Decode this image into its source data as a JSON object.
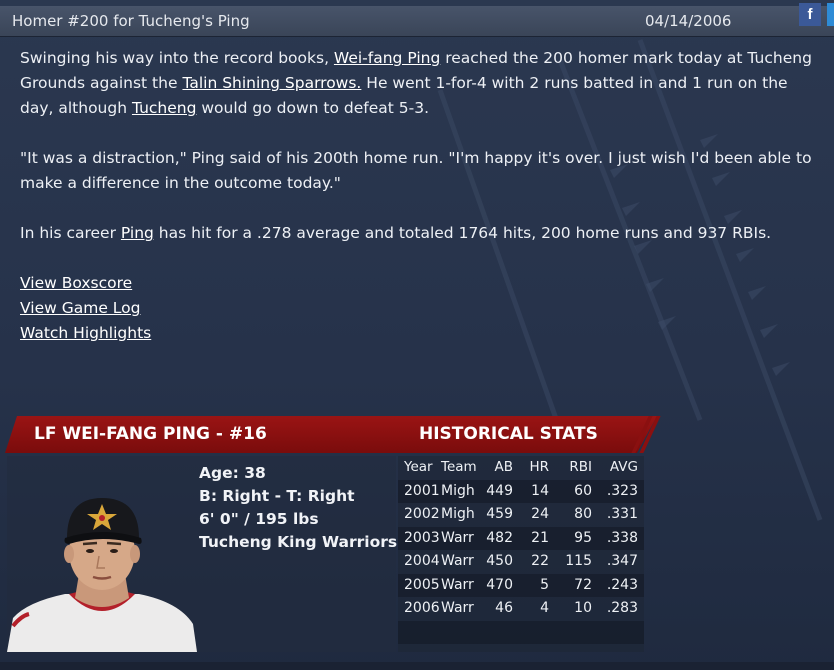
{
  "header": {
    "title": "Homer #200 for Tucheng's Ping",
    "date": "04/14/2006",
    "share_icon_label": "f"
  },
  "article": {
    "p1": {
      "t1": "Swinging his way into the record books, ",
      "link_player": "Wei-fang Ping",
      "t2": " reached the 200 homer mark today at Tucheng Grounds against the ",
      "link_opponent": "Talin Shining Sparrows.",
      "t3": " He went 1-for-4 with 2 runs batted in and 1 run on the day, although ",
      "link_team": "Tucheng",
      "t4": " would go down to defeat 5-3."
    },
    "p2": "\"It was a distraction,\" Ping said of his 200th home run. \"I'm happy it's over. I just wish I'd been able to make a difference in the outcome today.\"",
    "p3": {
      "t1": "In his career ",
      "link_player": "Ping",
      "t2": " has hit for a .278 average and totaled 1764 hits, 200 home runs and 937 RBIs."
    }
  },
  "links": {
    "boxscore": "View Boxscore",
    "game_log": "View Game Log",
    "highlights": "Watch Highlights"
  },
  "player": {
    "banner": "LF WEI-FANG PING - #16",
    "age": "Age: 38",
    "bats_throws": "B: Right - T: Right",
    "size": "6' 0\" / 195 lbs",
    "team": "Tucheng King Warriors"
  },
  "stats": {
    "title": "HISTORICAL STATS",
    "headers": {
      "year": "Year",
      "team": "Team",
      "ab": "AB",
      "hr": "HR",
      "rbi": "RBI",
      "avg": "AVG"
    },
    "rows": [
      {
        "year": "2001",
        "team": "Migh",
        "ab": "449",
        "hr": "14",
        "rbi": "60",
        "avg": ".323"
      },
      {
        "year": "2002",
        "team": "Migh",
        "ab": "459",
        "hr": "24",
        "rbi": "80",
        "avg": ".331"
      },
      {
        "year": "2003",
        "team": "Warr",
        "ab": "482",
        "hr": "21",
        "rbi": "95",
        "avg": ".338"
      },
      {
        "year": "2004",
        "team": "Warr",
        "ab": "450",
        "hr": "22",
        "rbi": "115",
        "avg": ".347"
      },
      {
        "year": "2005",
        "team": "Warr",
        "ab": "470",
        "hr": "5",
        "rbi": "72",
        "avg": ".243"
      },
      {
        "year": "2006",
        "team": "Warr",
        "ab": "46",
        "hr": "4",
        "rbi": "10",
        "avg": ".283"
      }
    ]
  },
  "colors": {
    "banner_red": "#8b1010",
    "facebook_blue": "#3b5998",
    "accent_blue": "#2e8bd6",
    "background": "#2b3850"
  },
  "icons": {
    "share": "facebook-icon"
  }
}
